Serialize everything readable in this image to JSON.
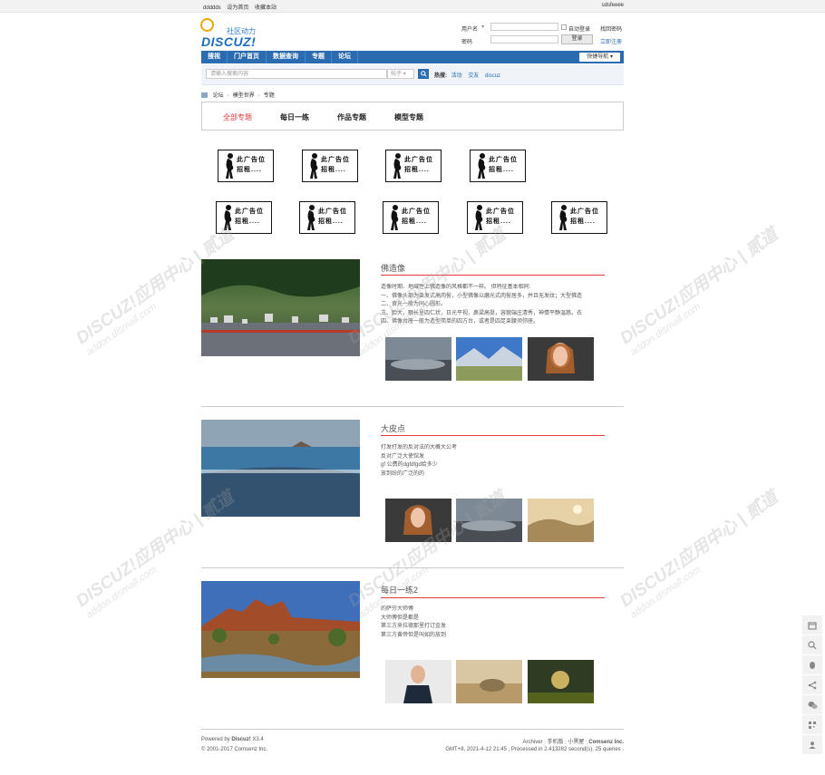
{
  "topbar": {
    "links": [
      "ddddds",
      "设为首页",
      "收藏本站"
    ],
    "user": "sdsfeeee",
    "close_icon": "×"
  },
  "logo": {
    "slogan": "社区动力",
    "word": "DISCUZ!"
  },
  "login": {
    "username_label": "用户名",
    "password_label": "密码",
    "autologin_label": "自动登录",
    "findpwd_label": "找回密码",
    "login_button": "登录",
    "register_label": "立即注册",
    "username_value": "",
    "password_value": ""
  },
  "nav": {
    "items": [
      "搜视",
      "门户首页",
      "数据查询",
      "专题",
      "论坛"
    ],
    "quick_label": "快捷导航"
  },
  "search": {
    "placeholder": "请输入搜索内容",
    "type": "帖子",
    "hot_label": "热搜:",
    "hot_items": [
      "活动",
      "交友",
      "discuz"
    ]
  },
  "breadcrumb": [
    "论坛",
    "模型世界",
    "专题"
  ],
  "tabs": [
    "全部专题",
    "每日一练",
    "作品专题",
    "模型专题"
  ],
  "ads": {
    "text_line1": "此广告位",
    "text_line2": "招租...."
  },
  "posts": [
    {
      "title": "佛造像",
      "body": [
        "造像时期、地域性上佛造像的风格都不一样。 但特征基本相同:",
        "一、佛像头部为束发式高肉髻，小型佛像以磨光式肉髻居多，并且无发纹；大型佛造",
        "二、背光一般为同心圆形。",
        "三、脸大，额长呈四仁状，日光平视，鼻梁高挺，容貌端庄清秀，神情平静温慈。衣",
        "四、佛像台座一般为造型简单的四方台，或者是四足束腰须弥座。"
      ]
    },
    {
      "title": "大皮点",
      "body": [
        " 打发打发的反对法的大概大公考",
        "反对广泛大使馆发",
        "gf 公费的dgfdfgd给多少",
        "放到纷的广泛的的"
      ]
    },
    {
      "title": "每日一练2",
      "body": [
        " 的萨芬大师傅",
        "大师傅但是都是",
        "第三方来拉德那里打订金发",
        "第三方黄帝但是叫如的放到"
      ]
    }
  ],
  "footer": {
    "powered": "Powered by",
    "product": "Discuz!",
    "version": "X3.4",
    "copyright": "© 2001-2017 Comsenz Inc.",
    "links": [
      "Archiver",
      "手机版",
      "小黑屋",
      "Comsenz Inc."
    ],
    "stats": "GMT+8, 2021-4-12 21:45 , Processed in 2.413282 second(s), 25 queries ."
  },
  "watermark": {
    "text": "DISCUZ!应用中心 | 贰道",
    "url": "addon.dismall.com"
  },
  "colors": {
    "nav": "#2b6cb0",
    "accent": "#e4393c",
    "link": "#2b6cb0"
  }
}
